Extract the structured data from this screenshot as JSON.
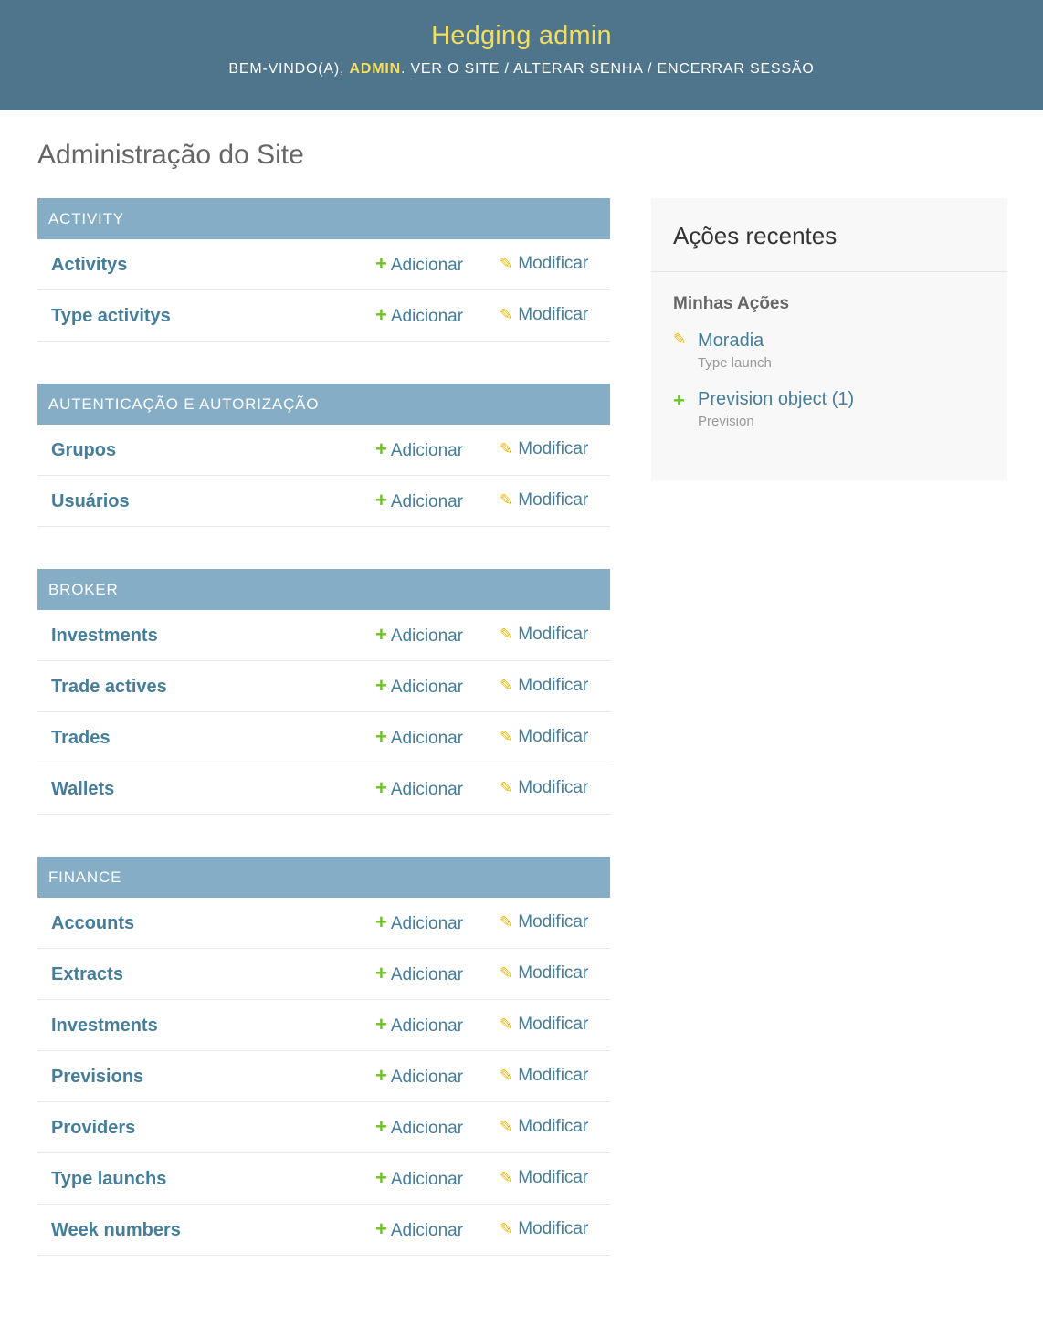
{
  "header": {
    "site_name": "Hedging admin",
    "welcome": "Bem-vindo(a),",
    "username": "admin",
    "links": [
      "Ver o site",
      "Alterar senha",
      "Encerrar sessão"
    ]
  },
  "page_title": "Administração do Site",
  "row_actions": {
    "add_label": "Adicionar",
    "change_label": "Modificar"
  },
  "modules": [
    {
      "caption": "Activity",
      "models": [
        "Activitys",
        "Type activitys"
      ]
    },
    {
      "caption": "Autenticação e Autorização",
      "models": [
        "Grupos",
        "Usuários"
      ]
    },
    {
      "caption": "Broker",
      "models": [
        "Investments",
        "Trade actives",
        "Trades",
        "Wallets"
      ]
    },
    {
      "caption": "Finance",
      "models": [
        "Accounts",
        "Extracts",
        "Investments",
        "Previsions",
        "Providers",
        "Type launchs",
        "Week numbers"
      ]
    }
  ],
  "recent_actions": {
    "title": "Ações recentes",
    "subtitle": "Minhas Ações",
    "items": [
      {
        "icon": "pencil-icon",
        "name": "Moradia",
        "type": "Type launch"
      },
      {
        "icon": "plus-icon",
        "name": "Prevision object (1)",
        "type": "Prevision"
      }
    ]
  },
  "colors": {
    "header_bg": "#4f758d",
    "site_name": "#f5dd5d",
    "caption_bg": "#85adc6",
    "link": "#447e9b",
    "add_icon": "#70bf2b",
    "change_icon": "#efb80b"
  }
}
